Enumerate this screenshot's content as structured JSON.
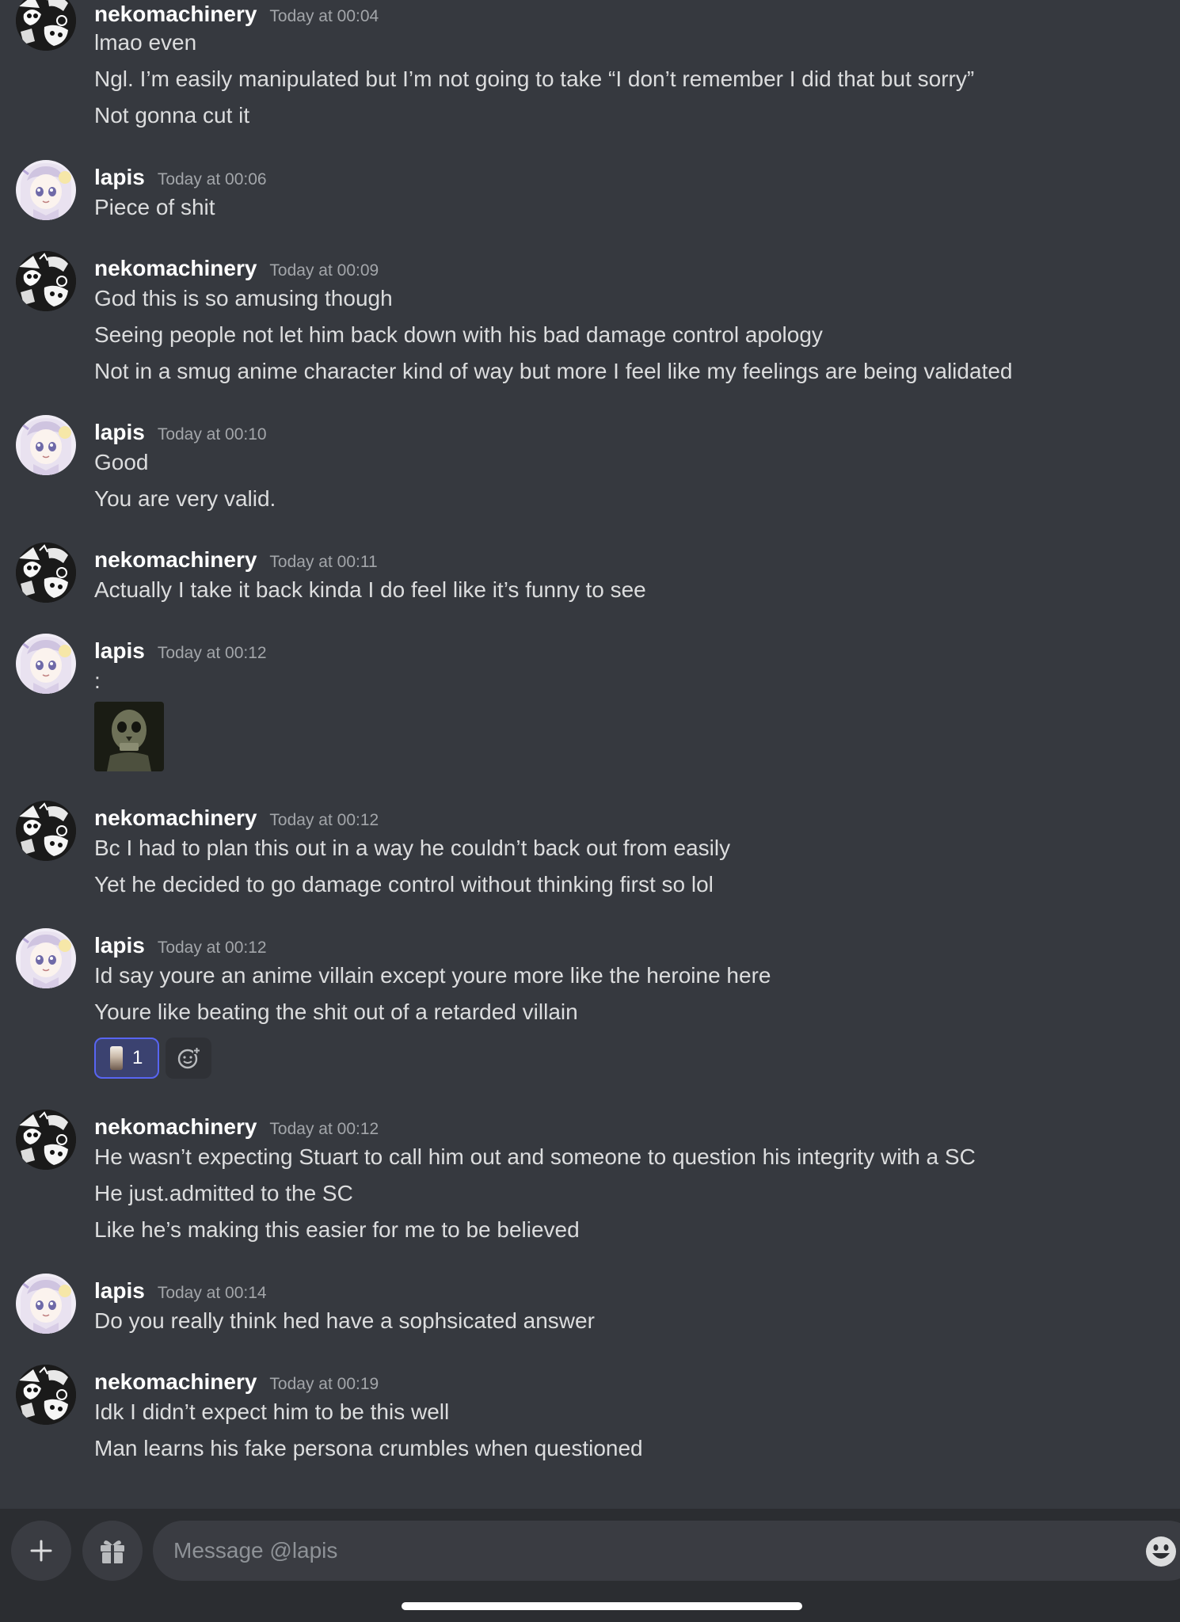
{
  "messages": [
    {
      "author": "nekomachinery",
      "timestamp": "Today at 00:04",
      "lines": [
        "lmao even",
        "Ngl. I’m easily manipulated but I’m not going to take “I don’t remember I did that but sorry”",
        "Not gonna cut it"
      ]
    },
    {
      "author": "lapis",
      "timestamp": "Today at 00:06",
      "lines": [
        "Piece of shit"
      ]
    },
    {
      "author": "nekomachinery",
      "timestamp": "Today at 00:09",
      "lines": [
        "God this is so amusing though",
        "Seeing people not let him back down with his bad damage control apology",
        "Not in a smug anime character kind of way but more I feel like my feelings are being validated"
      ]
    },
    {
      "author": "lapis",
      "timestamp": "Today at 00:10",
      "lines": [
        "Good",
        "You are very valid."
      ]
    },
    {
      "author": "nekomachinery",
      "timestamp": "Today at 00:11",
      "lines": [
        "Actually I take it back kinda I do feel like it’s funny to see"
      ]
    },
    {
      "author": "lapis",
      "timestamp": "Today at 00:12",
      "lines": [
        ":"
      ]
    },
    {
      "author": "nekomachinery",
      "timestamp": "Today at 00:12",
      "lines": [
        "Bc I had to plan this out in a way he couldn’t back out from easily",
        "Yet he decided to go damage control without thinking first so lol"
      ]
    },
    {
      "author": "lapis",
      "timestamp": "Today at 00:12",
      "lines": [
        "Id say youre an anime villain except youre more like the heroine here",
        "Youre like beating the shit out of a retarded villain"
      ],
      "reaction_count": "1"
    },
    {
      "author": "nekomachinery",
      "timestamp": "Today at 00:12",
      "lines": [
        "He wasn’t expecting Stuart to call him out and someone to question his integrity with a SC",
        "He just.admitted to the SC",
        "Like he’s making this easier for me to be believed"
      ]
    },
    {
      "author": "lapis",
      "timestamp": "Today at 00:14",
      "lines": [
        "Do you really think hed have a sophsicated answer"
      ]
    },
    {
      "author": "nekomachinery",
      "timestamp": "Today at 00:19",
      "lines": [
        "Idk I didn’t expect him to be this well",
        "Man learns his fake persona crumbles when questioned"
      ]
    }
  ],
  "composer": {
    "placeholder": "Message @lapis",
    "icons": [
      "plus-icon",
      "gift-icon",
      "emoji-icon"
    ]
  },
  "colors": {
    "background": "#36393f",
    "composer_background": "#2b2d31",
    "username": "#ffffff",
    "timestamp": "#a3a6aa",
    "text": "#dcddde",
    "reaction_accent": "#5865f2"
  }
}
